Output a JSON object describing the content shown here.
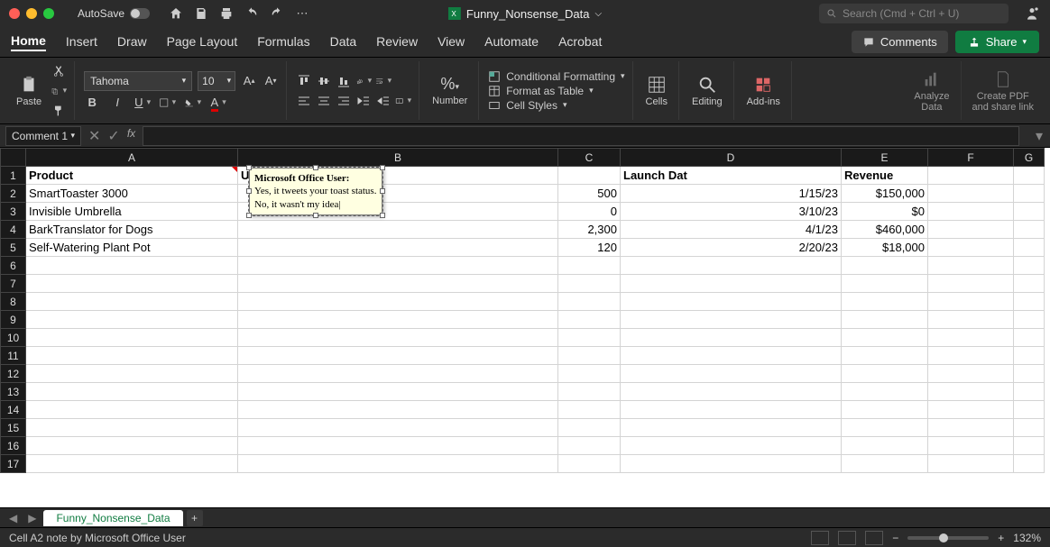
{
  "titlebar": {
    "autosave_label": "AutoSave",
    "doc_name": "Funny_Nonsense_Data",
    "search_placeholder": "Search (Cmd + Ctrl + U)"
  },
  "tabs": {
    "items": [
      "Home",
      "Insert",
      "Draw",
      "Page Layout",
      "Formulas",
      "Data",
      "Review",
      "View",
      "Automate",
      "Acrobat"
    ],
    "active": "Home",
    "comments_label": "Comments",
    "share_label": "Share"
  },
  "ribbon": {
    "paste_label": "Paste",
    "font_name": "Tahoma",
    "font_size": "10",
    "number_label": "Number",
    "cond_fmt": "Conditional Formatting",
    "fmt_table": "Format as Table",
    "cell_styles": "Cell Styles",
    "cells_label": "Cells",
    "editing_label": "Editing",
    "addins_label": "Add-ins",
    "analyze_label1": "Analyze",
    "analyze_label2": "Data",
    "pdf_label1": "Create PDF",
    "pdf_label2": "and share link"
  },
  "fbar": {
    "namebox": "Comment 1"
  },
  "grid": {
    "cols": [
      "A",
      "B",
      "C",
      "D",
      "E",
      "F",
      "G"
    ],
    "rows": 17,
    "headers": {
      "A": "Product",
      "B": "U",
      "C": "",
      "D": "Launch Dat",
      "E": "Revenue"
    },
    "data": [
      {
        "A": "SmartToaster 3000",
        "C": "500",
        "D": "1/15/23",
        "E": "$150,000"
      },
      {
        "A": "Invisible Umbrella",
        "C": "0",
        "D": "3/10/23",
        "E": "$0"
      },
      {
        "A": "BarkTranslator for Dogs",
        "C": "2,300",
        "D": "4/1/23",
        "E": "$460,000"
      },
      {
        "A": "Self-Watering Plant Pot",
        "C": "120",
        "D": "2/20/23",
        "E": "$18,000"
      }
    ]
  },
  "note": {
    "author": "Microsoft Office User:",
    "body": "Yes, it tweets your toast status. No, it wasn't my idea"
  },
  "sheetbar": {
    "tab_name": "Funny_Nonsense_Data"
  },
  "status": {
    "text": "Cell A2 note by Microsoft Office User",
    "zoom": "132%"
  }
}
